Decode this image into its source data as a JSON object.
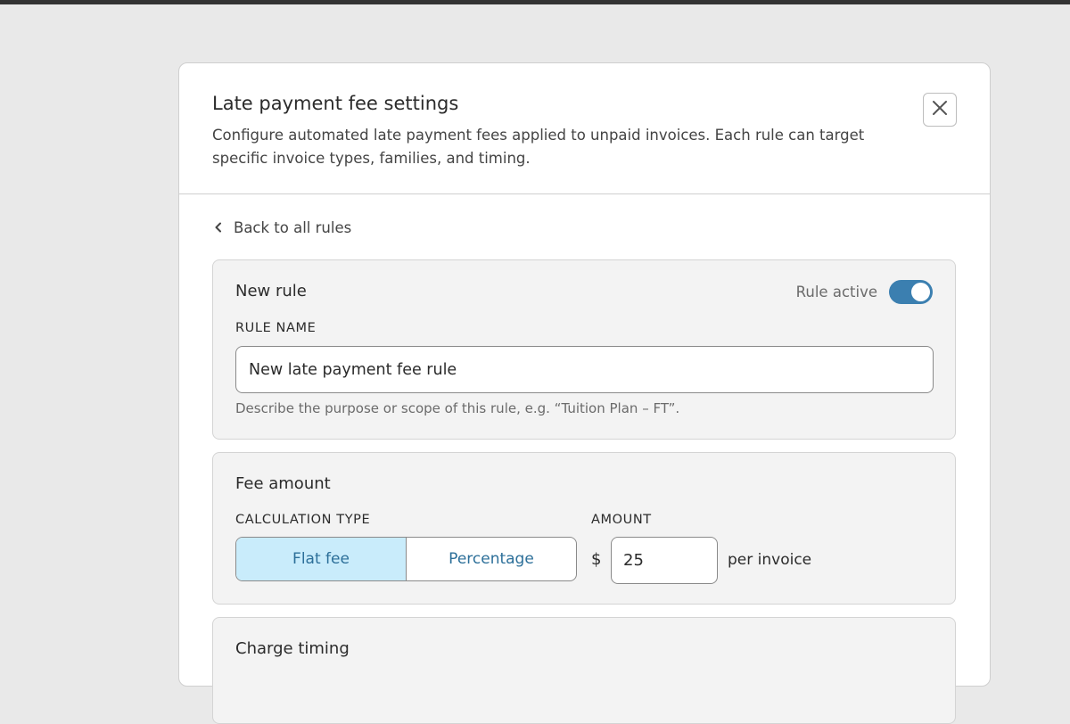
{
  "dialog": {
    "title": "Late payment fee settings",
    "description": "Configure automated late payment fees applied to unpaid invoices. Each rule can target specific invoice types, families, and timing."
  },
  "back_link": {
    "label": "Back to all rules"
  },
  "rule_card": {
    "title": "New rule",
    "toggle_label": "Rule active",
    "toggle_on": true,
    "name_label": "RULE NAME",
    "name_value": "New late payment fee rule",
    "help_text": "Describe the purpose or scope of this rule, e.g. “Tuition Plan – FT”."
  },
  "fee_card": {
    "title": "Fee amount",
    "calc_label": "CALCULATION TYPE",
    "options": [
      "Flat fee",
      "Percentage"
    ],
    "selected_option": "Flat fee",
    "amount_label": "AMOUNT",
    "currency_symbol": "$",
    "amount_value": "25",
    "amount_suffix": "per invoice"
  },
  "timing_card": {
    "title": "Charge timing"
  },
  "colors": {
    "accent": "#3b7fb0",
    "active_segment_bg": "#c9ecfb",
    "segment_text": "#2c6f99"
  }
}
